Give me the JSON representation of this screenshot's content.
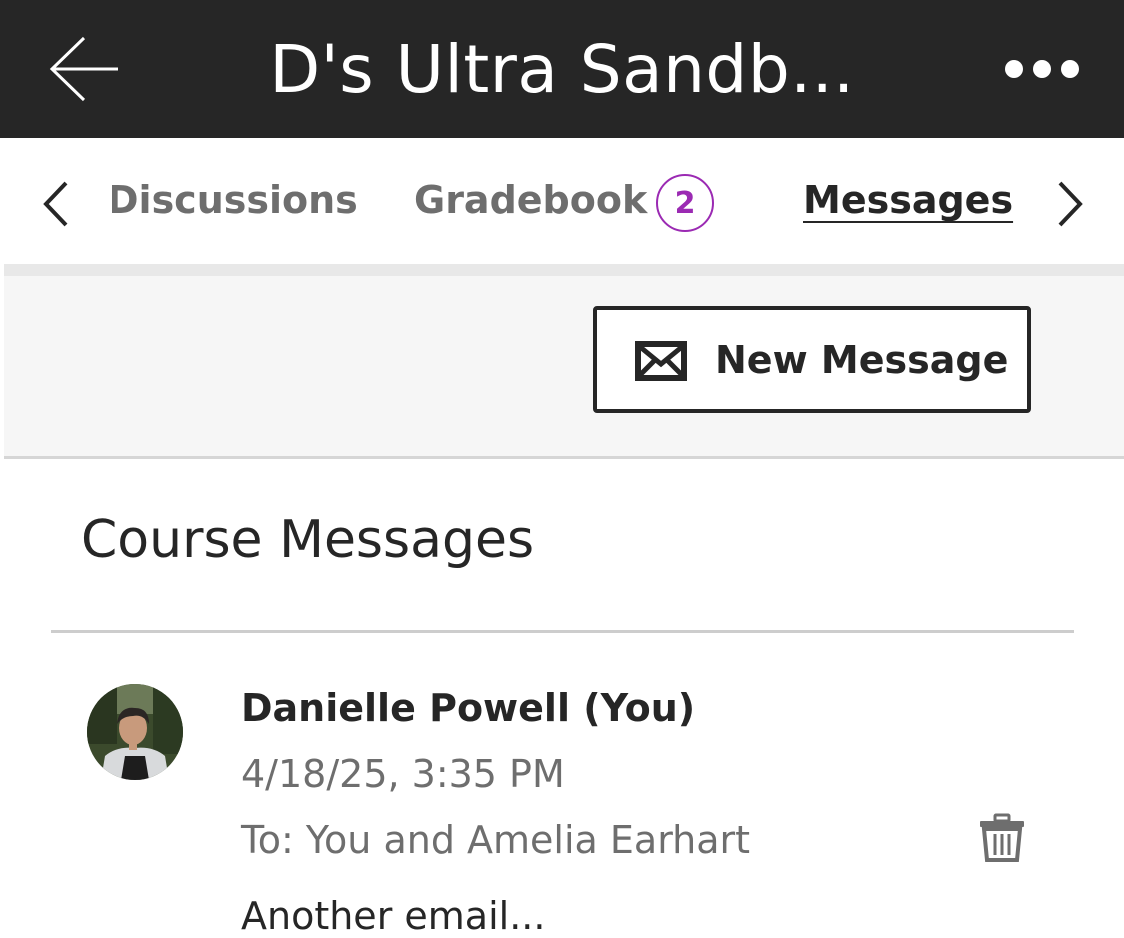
{
  "header": {
    "title": "D's Ultra Sandb...",
    "back_icon": "arrow-left-icon",
    "more_icon": "more-horizontal-icon"
  },
  "tabs": {
    "items": [
      {
        "label": "Discussions",
        "active": false
      },
      {
        "label": "Gradebook",
        "active": false,
        "badge": "2"
      },
      {
        "label": "Messages",
        "active": true
      }
    ],
    "prev_icon": "chevron-left-icon",
    "next_icon": "chevron-right-icon",
    "badge_color": "#9b2ab3"
  },
  "toolbar": {
    "new_message_label": "New Message",
    "new_message_icon": "envelope-icon"
  },
  "main": {
    "section_title": "Course Messages",
    "messages": [
      {
        "sender": "Danielle Powell (You)",
        "date": "4/18/25, 3:35 PM",
        "recipients": "To: You and Amelia Earhart",
        "preview": "Another email...",
        "delete_icon": "trash-icon"
      }
    ]
  },
  "colors": {
    "header_bg": "#262626",
    "accent": "#9b2ab3",
    "muted_text": "#6e6e6e"
  }
}
